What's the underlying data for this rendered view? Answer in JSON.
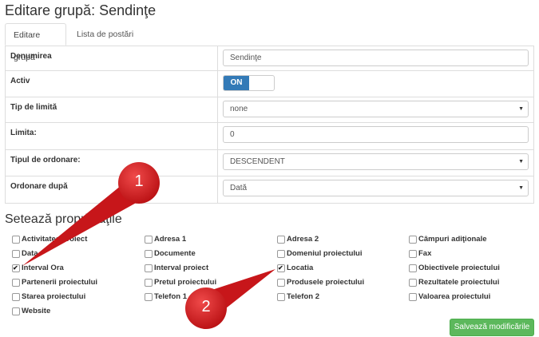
{
  "page": {
    "title": "Editare grupă: Sendinţe"
  },
  "tabs": [
    {
      "label": "Editare grupă"
    },
    {
      "label": "Lista de postări"
    }
  ],
  "form": {
    "denumirea": {
      "label": "Denumirea",
      "value": "Sendinţe"
    },
    "activ": {
      "label": "Activ",
      "state": "ON"
    },
    "tip_limita": {
      "label": "Tip de limită",
      "value": "none"
    },
    "limita": {
      "label": "Limita:",
      "value": "0"
    },
    "tip_ordonare": {
      "label": "Tipul de ordonare:",
      "value": "DESCENDENT"
    },
    "ordonare_dupa": {
      "label": "Ordonare după",
      "value": "Dată"
    }
  },
  "properties": {
    "title": "Setează proprietăţile",
    "items": [
      {
        "label": "Activitatea proiect",
        "checked": false
      },
      {
        "label": "Adresa 1",
        "checked": false
      },
      {
        "label": "Adresa 2",
        "checked": false
      },
      {
        "label": "Câmpuri adiţionale",
        "checked": false
      },
      {
        "label": "Data",
        "checked": false
      },
      {
        "label": "Documente",
        "checked": false
      },
      {
        "label": "Domeniul proiectului",
        "checked": false
      },
      {
        "label": "Fax",
        "checked": false
      },
      {
        "label": "Interval Ora",
        "checked": true
      },
      {
        "label": "Interval proiect",
        "checked": false
      },
      {
        "label": "Locatia",
        "checked": true
      },
      {
        "label": "Obiectivele proiectului",
        "checked": false
      },
      {
        "label": "Partenerii proiectului",
        "checked": false
      },
      {
        "label": "Pretul proiectului",
        "checked": false
      },
      {
        "label": "Produsele proiectului",
        "checked": false
      },
      {
        "label": "Rezultatele proiectului",
        "checked": false
      },
      {
        "label": "Starea proiectului",
        "checked": false
      },
      {
        "label": "Telefon 1",
        "checked": false
      },
      {
        "label": "Telefon 2",
        "checked": false
      },
      {
        "label": "Valoarea proiectului",
        "checked": false
      },
      {
        "label": "Website",
        "checked": false
      }
    ]
  },
  "save_button": {
    "label": "Salvează modificările"
  },
  "annotations": {
    "marker1": "1",
    "marker2": "2",
    "color": "#d7191c"
  },
  "colors": {
    "primary": "#337ab7",
    "success": "#5cb85c"
  }
}
